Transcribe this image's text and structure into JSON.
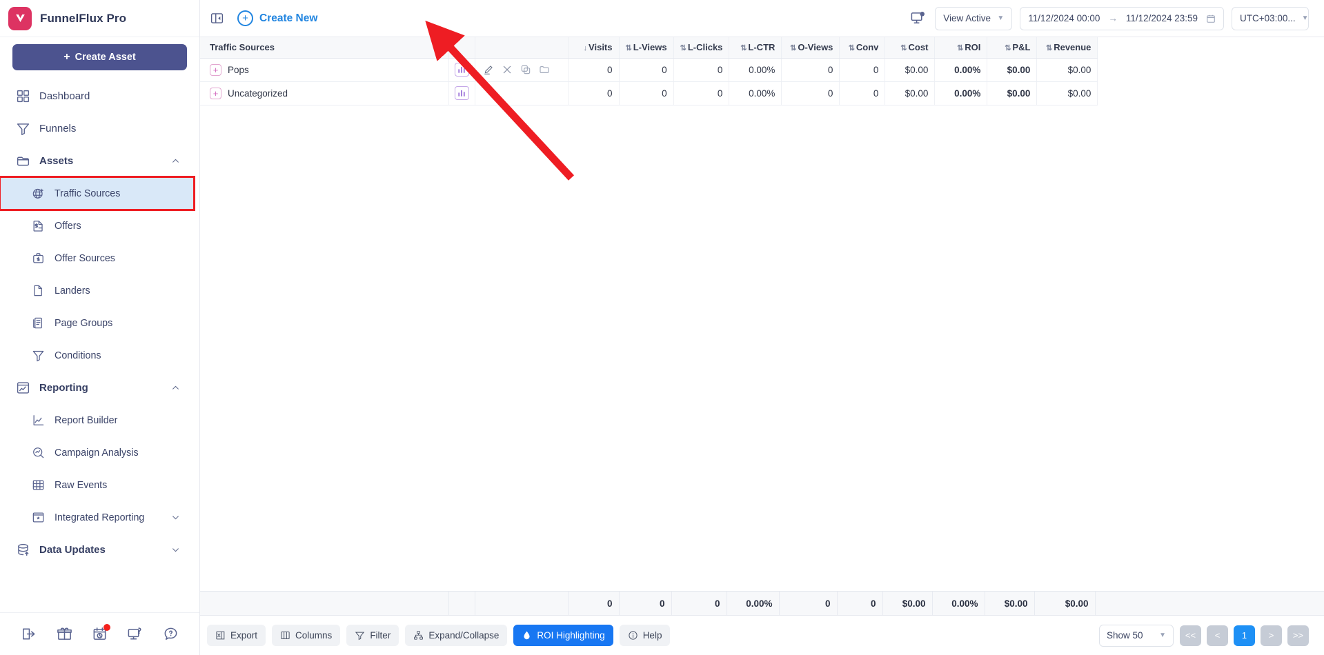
{
  "brand": {
    "name": "FunnelFlux Pro",
    "logo_icon": "funnelflux-logo-icon",
    "collapse_icon": "sidebar-collapse-icon"
  },
  "sidebar": {
    "create_asset_label": "Create Asset",
    "items": [
      {
        "label": "Dashboard",
        "icon": "dashboard-grid-icon",
        "level": "top"
      },
      {
        "label": "Funnels",
        "icon": "funnel-icon",
        "level": "top"
      },
      {
        "label": "Assets",
        "icon": "assets-folder-icon",
        "level": "group",
        "expanded": true
      },
      {
        "label": "Traffic Sources",
        "icon": "traffic-sources-globe-icon",
        "level": "sub",
        "active": true
      },
      {
        "label": "Offers",
        "icon": "offers-dollar-doc-icon",
        "level": "sub"
      },
      {
        "label": "Offer Sources",
        "icon": "offer-sources-briefcase-icon",
        "level": "sub"
      },
      {
        "label": "Landers",
        "icon": "landers-page-icon",
        "level": "sub"
      },
      {
        "label": "Page Groups",
        "icon": "page-groups-icon",
        "level": "sub"
      },
      {
        "label": "Conditions",
        "icon": "conditions-funnel-icon",
        "level": "sub"
      },
      {
        "label": "Reporting",
        "icon": "reporting-chart-icon",
        "level": "group",
        "expanded": true
      },
      {
        "label": "Report Builder",
        "icon": "report-builder-line-chart-icon",
        "level": "sub"
      },
      {
        "label": "Campaign Analysis",
        "icon": "campaign-analysis-magnifier-icon",
        "level": "sub"
      },
      {
        "label": "Raw Events",
        "icon": "raw-events-table-icon",
        "level": "sub"
      },
      {
        "label": "Integrated Reporting",
        "icon": "integrated-reporting-icon",
        "level": "sub",
        "expandable": true
      },
      {
        "label": "Data Updates",
        "icon": "data-updates-database-icon",
        "level": "group",
        "expandable": true
      }
    ],
    "footer_icons": [
      "logout-icon",
      "gift-icon",
      "changelog-clock-icon",
      "support-monitor-icon",
      "help-question-icon"
    ]
  },
  "topbar": {
    "create_new_label": "Create New",
    "create_new_icon": "plus-circle-icon",
    "monitor_icon": "session-monitor-icon",
    "view_filter": "View Active",
    "date_from": "11/12/2024 00:00",
    "date_to": "11/12/2024 23:59",
    "date_separator": "→",
    "calendar_icon": "calendar-icon",
    "timezone": "UTC+03:00..."
  },
  "table": {
    "columns": [
      {
        "key": "name",
        "label": "Traffic Sources",
        "sort": "",
        "align": "left"
      },
      {
        "key": "chart",
        "label": "",
        "sort": "",
        "align": "center"
      },
      {
        "key": "actions",
        "label": "",
        "sort": "",
        "align": "left"
      },
      {
        "key": "visits",
        "label": "Visits",
        "sort": "↓",
        "align": "right"
      },
      {
        "key": "lviews",
        "label": "L-Views",
        "sort": "⇅",
        "align": "right"
      },
      {
        "key": "lclicks",
        "label": "L-Clicks",
        "sort": "⇅",
        "align": "right"
      },
      {
        "key": "lctr",
        "label": "L-CTR",
        "sort": "⇅",
        "align": "right"
      },
      {
        "key": "oviews",
        "label": "O-Views",
        "sort": "⇅",
        "align": "right"
      },
      {
        "key": "conv",
        "label": "Conv",
        "sort": "⇅",
        "align": "right"
      },
      {
        "key": "cost",
        "label": "Cost",
        "sort": "⇅",
        "align": "right"
      },
      {
        "key": "roi",
        "label": "ROI",
        "sort": "⇅",
        "align": "right"
      },
      {
        "key": "pl",
        "label": "P&L",
        "sort": "⇅",
        "align": "right"
      },
      {
        "key": "revenue",
        "label": "Revenue",
        "sort": "⇅",
        "align": "right"
      }
    ],
    "rows": [
      {
        "name": "Pops",
        "expand_icon": "expand-plus-icon",
        "chart_icon": "row-chart-icon",
        "actions": [
          "edit-pencil-icon",
          "delete-x-icon",
          "duplicate-copy-icon",
          "move-folder-icon"
        ],
        "visits": "0",
        "lviews": "0",
        "lclicks": "0",
        "lctr": "0.00%",
        "oviews": "0",
        "conv": "0",
        "cost": "$0.00",
        "roi": "0.00%",
        "pl": "$0.00",
        "revenue": "$0.00"
      },
      {
        "name": "Uncategorized",
        "expand_icon": "expand-plus-icon",
        "chart_icon": "row-chart-icon",
        "actions": [],
        "visits": "0",
        "lviews": "0",
        "lclicks": "0",
        "lctr": "0.00%",
        "oviews": "0",
        "conv": "0",
        "cost": "$0.00",
        "roi": "0.00%",
        "pl": "$0.00",
        "revenue": "$0.00"
      }
    ],
    "totals": {
      "visits": "0",
      "lviews": "0",
      "lclicks": "0",
      "lctr": "0.00%",
      "oviews": "0",
      "conv": "0",
      "cost": "$0.00",
      "roi": "0.00%",
      "pl": "$0.00",
      "revenue": "$0.00"
    }
  },
  "bottombar": {
    "buttons": [
      {
        "label": "Export",
        "icon": "export-excel-icon",
        "accent": false
      },
      {
        "label": "Columns",
        "icon": "columns-icon",
        "accent": false
      },
      {
        "label": "Filter",
        "icon": "filter-funnel-icon",
        "accent": false
      },
      {
        "label": "Expand/Collapse",
        "icon": "expand-collapse-tree-icon",
        "accent": false
      },
      {
        "label": "ROI Highlighting",
        "icon": "roi-droplet-icon",
        "accent": true
      },
      {
        "label": "Help",
        "icon": "help-info-icon",
        "accent": false
      }
    ],
    "page_size": "Show 50",
    "pagination": [
      "<<",
      "<",
      "1",
      ">",
      ">>"
    ],
    "current_page": "1"
  },
  "colors": {
    "brand_pink": "#dd3362",
    "primary_blue": "#1877f2",
    "sidebar_active": "#d9e8f8",
    "annotation_red": "#ee1d23",
    "create_asset_purple": "#4c538f",
    "link_blue": "#2185e0"
  }
}
